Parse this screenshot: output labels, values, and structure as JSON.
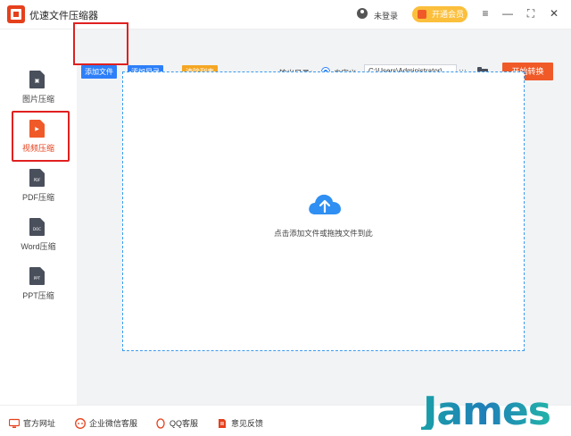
{
  "app": {
    "title": "优速文件压缩器"
  },
  "header": {
    "login": "未登录",
    "vip": "开通会员"
  },
  "window_controls": {
    "menu": "≡",
    "minimize": "—",
    "maximize": "⛶",
    "close": "✕"
  },
  "sidebar": {
    "items": [
      {
        "label": "图片压缩",
        "tag": "",
        "icon": "image-file-icon"
      },
      {
        "label": "视频压缩",
        "tag": "▶",
        "icon": "video-file-icon",
        "active": true
      },
      {
        "label": "PDF压缩",
        "tag": "PDF",
        "icon": "pdf-file-icon"
      },
      {
        "label": "Word压缩",
        "tag": "DOC",
        "icon": "word-file-icon"
      },
      {
        "label": "PPT压缩",
        "tag": "PPT",
        "icon": "ppt-file-icon"
      }
    ]
  },
  "toolbar": {
    "add_file": "添加文件",
    "add_folder": "添加目录",
    "clear_list": "清除列表",
    "output_label": "输出目录：",
    "custom_label": "自定义",
    "output_path": "C:\\Users\\Administrator\\",
    "more": "···",
    "start": "开始转换"
  },
  "dropzone": {
    "hint": "点击添加文件或拖拽文件到此"
  },
  "footer": {
    "website": "官方网址",
    "wechat": "企业微信客服",
    "qq": "QQ客服",
    "feedback": "意见反馈"
  },
  "watermark": {
    "text": "James"
  },
  "colors": {
    "accent_orange": "#f05a28",
    "blue": "#2d7ff9",
    "yellow": "#f5a623",
    "highlight_red": "#e02020",
    "vip_yellow": "#fbbf3c"
  }
}
